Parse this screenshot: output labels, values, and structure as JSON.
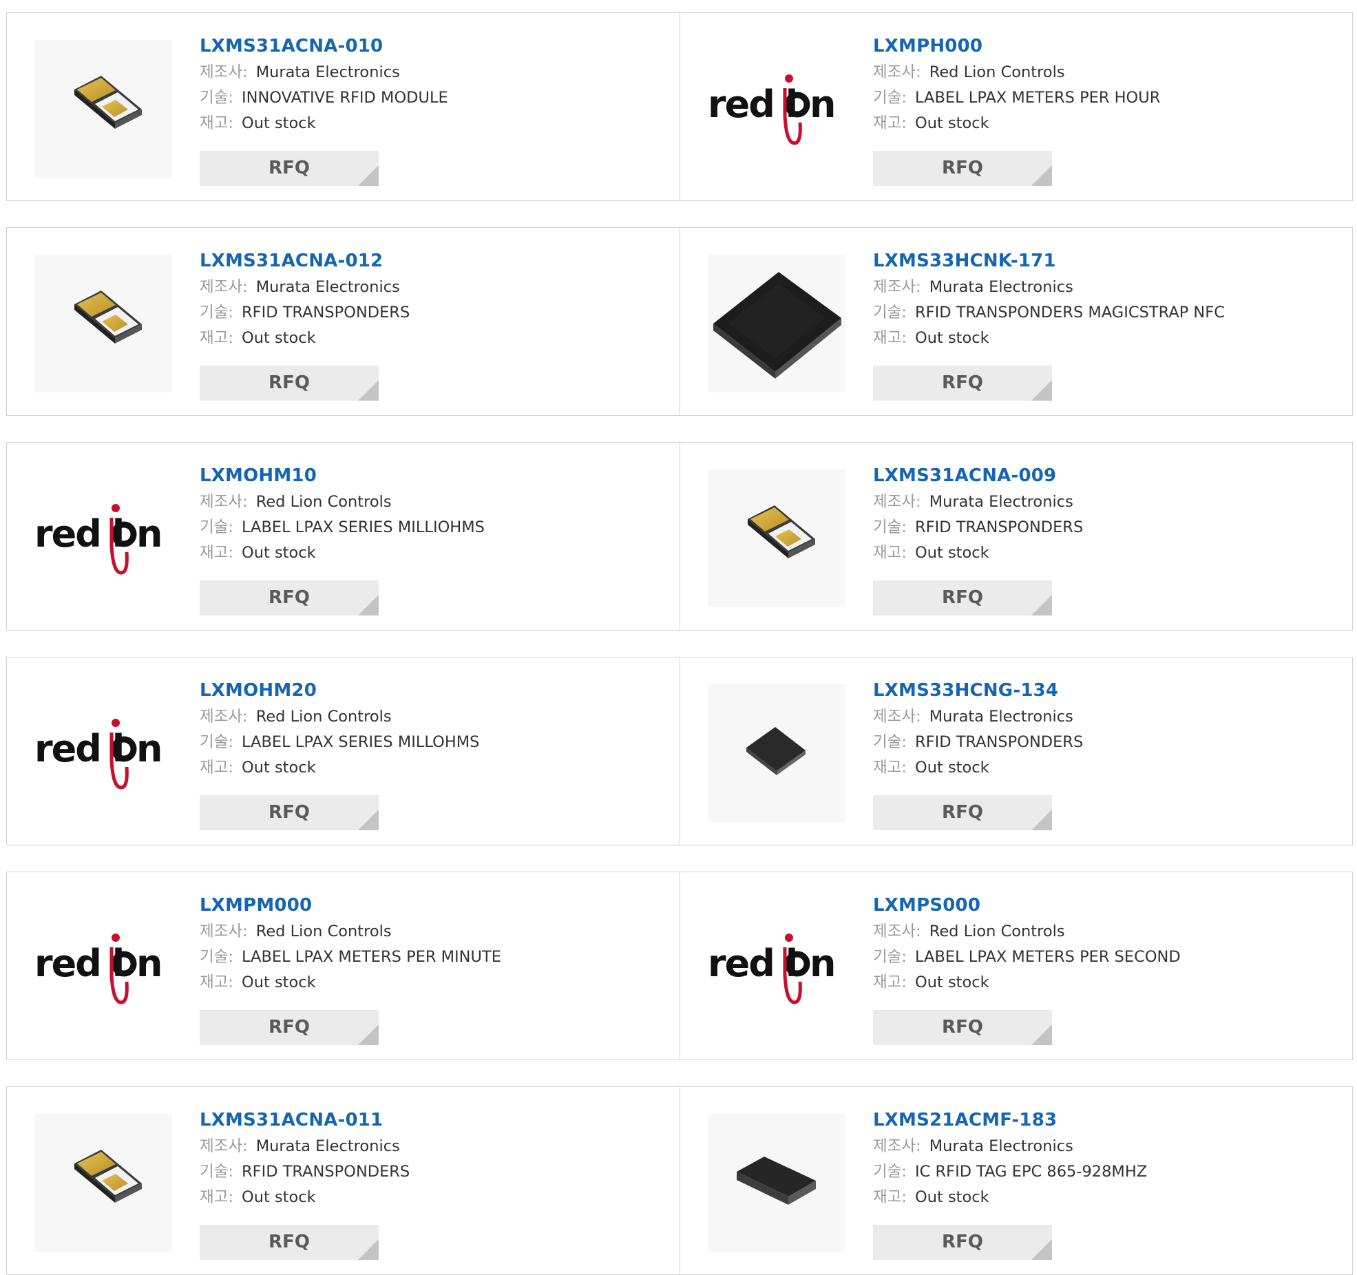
{
  "labels": {
    "manufacturer": "제조사",
    "description": "기술",
    "stock": "재고"
  },
  "products": [
    {
      "part_number": "LXMS31ACNA-010",
      "manufacturer": "Murata Electronics",
      "description": "INNOVATIVE RFID MODULE",
      "stock": "Out stock",
      "image": "murata-tag-chip",
      "button": "RFQ"
    },
    {
      "part_number": "LXMPH000",
      "manufacturer": "Red Lion Controls",
      "description": "LABEL LPAX METERS PER HOUR",
      "stock": "Out stock",
      "image": "red-lion-logo",
      "button": "RFQ"
    },
    {
      "part_number": "LXMS31ACNA-012",
      "manufacturer": "Murata Electronics",
      "description": "RFID TRANSPONDERS",
      "stock": "Out stock",
      "image": "murata-tag-chip",
      "button": "RFQ"
    },
    {
      "part_number": "LXMS33HCNK-171",
      "manufacturer": "Murata Electronics",
      "description": "RFID TRANSPONDERS MAGICSTRAP NFC",
      "stock": "Out stock",
      "image": "black-square-module",
      "button": "RFQ"
    },
    {
      "part_number": "LXMOHM10",
      "manufacturer": "Red Lion Controls",
      "description": "LABEL LPAX SERIES MILLIOHMS",
      "stock": "Out stock",
      "image": "red-lion-logo",
      "button": "RFQ"
    },
    {
      "part_number": "LXMS31ACNA-009",
      "manufacturer": "Murata Electronics",
      "description": "RFID TRANSPONDERS",
      "stock": "Out stock",
      "image": "murata-tag-chip",
      "button": "RFQ"
    },
    {
      "part_number": "LXMOHM20",
      "manufacturer": "Red Lion Controls",
      "description": "LABEL LPAX SERIES MILLOHMS",
      "stock": "Out stock",
      "image": "red-lion-logo",
      "button": "RFQ"
    },
    {
      "part_number": "LXMS33HCNG-134",
      "manufacturer": "Murata Electronics",
      "description": "RFID TRANSPONDERS",
      "stock": "Out stock",
      "image": "small-black-chip",
      "button": "RFQ"
    },
    {
      "part_number": "LXMPM000",
      "manufacturer": "Red Lion Controls",
      "description": "LABEL LPAX METERS PER MINUTE",
      "stock": "Out stock",
      "image": "red-lion-logo",
      "button": "RFQ"
    },
    {
      "part_number": "LXMPS000",
      "manufacturer": "Red Lion Controls",
      "description": "LABEL LPAX METERS PER SECOND",
      "stock": "Out stock",
      "image": "red-lion-logo",
      "button": "RFQ"
    },
    {
      "part_number": "LXMS31ACNA-011",
      "manufacturer": "Murata Electronics",
      "description": "RFID TRANSPONDERS",
      "stock": "Out stock",
      "image": "murata-tag-chip",
      "button": "RFQ"
    },
    {
      "part_number": "LXMS21ACMF-183",
      "manufacturer": "Murata Electronics",
      "description": "IC RFID TAG EPC 865-928MHZ",
      "stock": "Out stock",
      "image": "black-rect-chip",
      "button": "RFQ"
    }
  ],
  "colors": {
    "link": "#1565b5",
    "label": "#9a9a9a",
    "text": "#333333",
    "border": "#d2d2d2",
    "button_bg": "#ebebeb",
    "logo_red": "#c8102e"
  },
  "icons": [
    "murata-tag-chip",
    "red-lion-logo",
    "black-square-module",
    "small-black-chip",
    "black-rect-chip"
  ]
}
